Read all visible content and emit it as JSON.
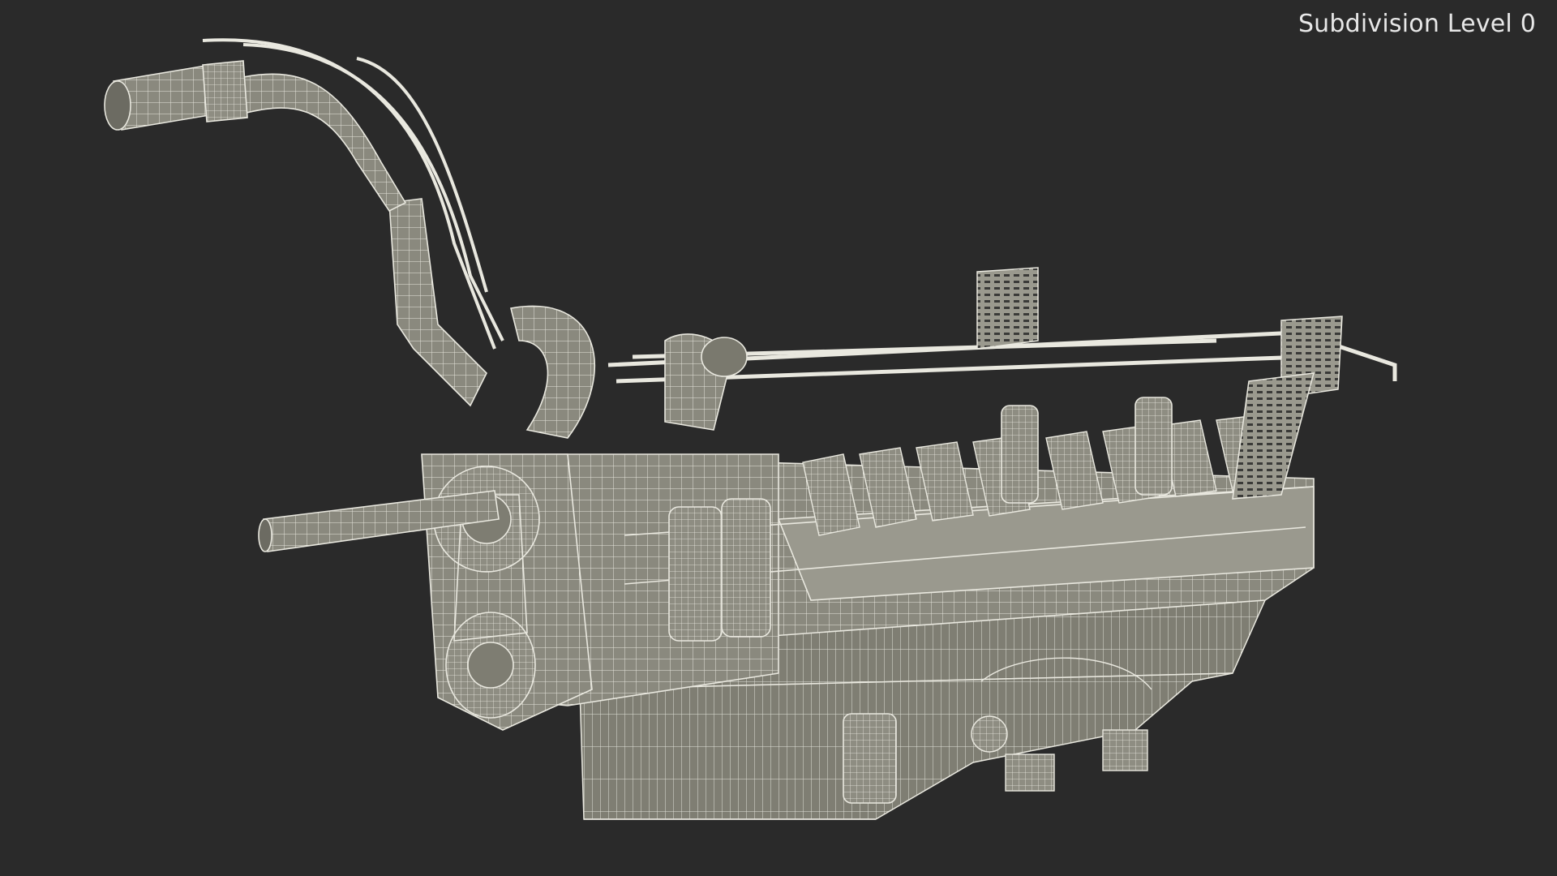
{
  "viewport": {
    "overlay_label": "Subdivision Level 0",
    "background_color": "#2a2a2a",
    "model_fill_color": "#8c8b80",
    "wire_color": "#e9e8df"
  },
  "model": {
    "subject": "engine-wireframe-render"
  }
}
